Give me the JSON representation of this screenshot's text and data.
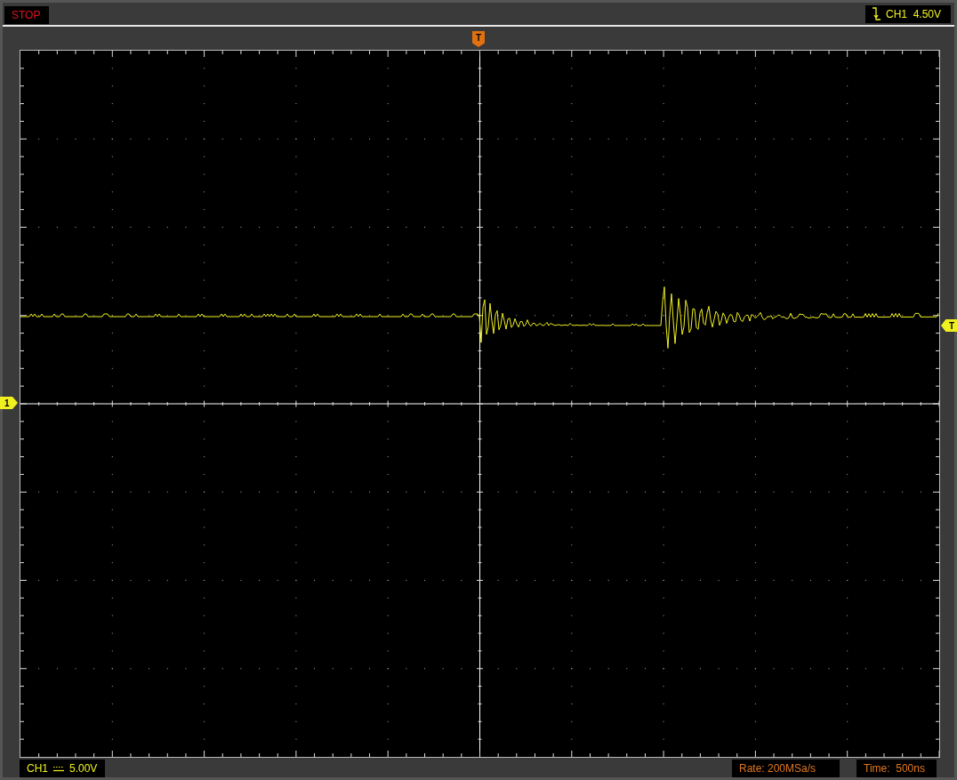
{
  "status": {
    "run_state": "STOP"
  },
  "trigger": {
    "source": "CH1",
    "voltage": "4.50V"
  },
  "markers": {
    "trigger_position": "T",
    "channel_ground": "1",
    "trigger_level": "T"
  },
  "channel": {
    "name": "CH1",
    "scale": "5.00V"
  },
  "rate": "Rate: 200MSa/s",
  "time": "Time:  500ns"
}
